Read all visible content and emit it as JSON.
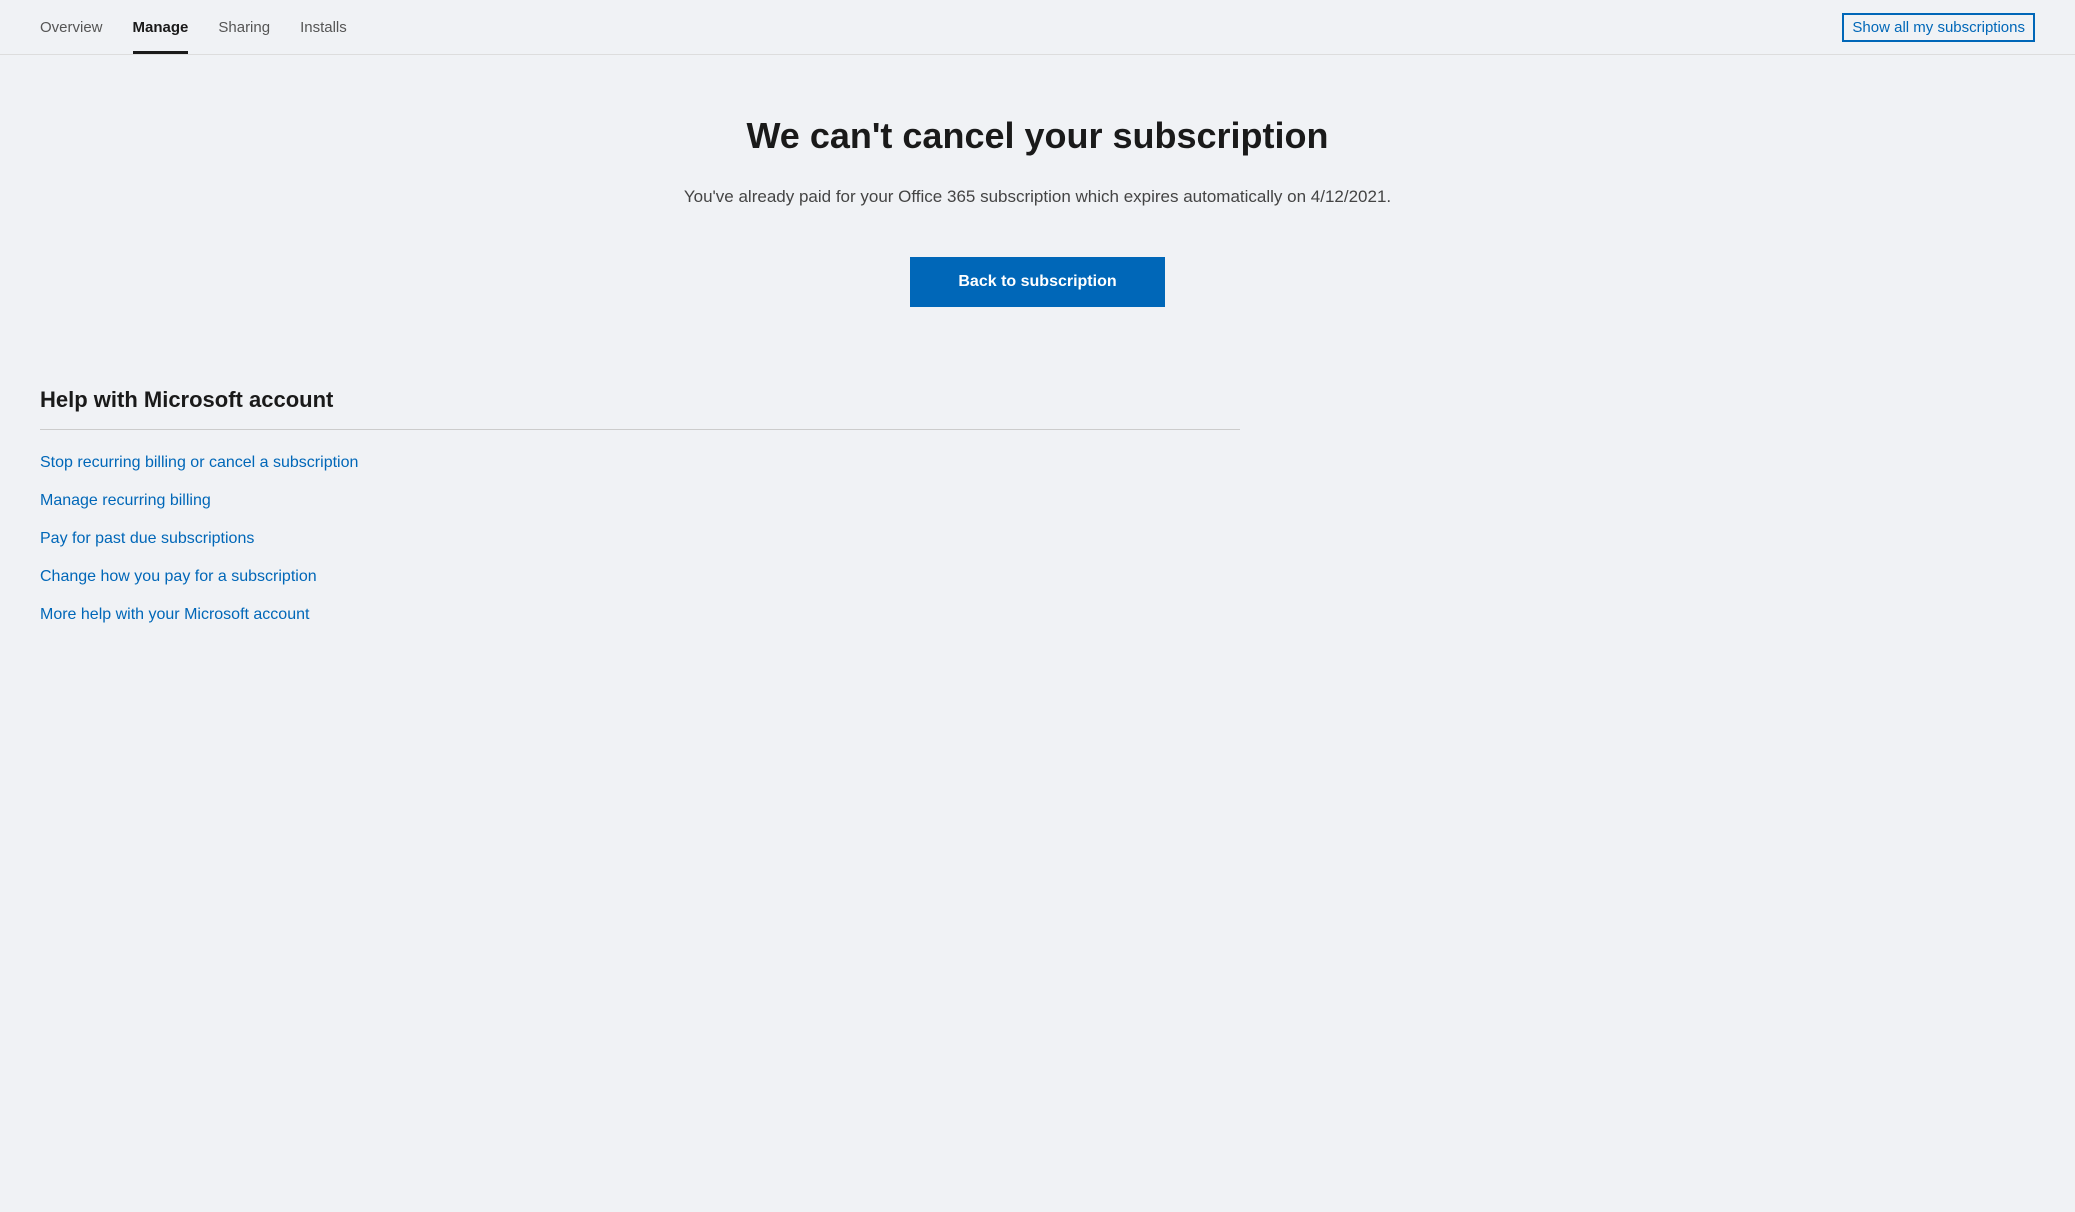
{
  "nav": {
    "tabs": [
      {
        "id": "overview",
        "label": "Overview",
        "active": false
      },
      {
        "id": "manage",
        "label": "Manage",
        "active": true
      },
      {
        "id": "sharing",
        "label": "Sharing",
        "active": false
      },
      {
        "id": "installs",
        "label": "Installs",
        "active": false
      }
    ],
    "show_all_label": "Show all my subscriptions"
  },
  "main": {
    "error_title": "We can't cancel your subscription",
    "error_description": "You've already paid for your Office 365 subscription which expires automatically on 4/12/2021.",
    "back_button_label": "Back to subscription"
  },
  "help": {
    "section_title": "Help with Microsoft account",
    "links": [
      {
        "id": "stop-recurring",
        "label": "Stop recurring billing or cancel a subscription"
      },
      {
        "id": "manage-recurring",
        "label": "Manage recurring billing"
      },
      {
        "id": "pay-past-due",
        "label": "Pay for past due subscriptions"
      },
      {
        "id": "change-payment",
        "label": "Change how you pay for a subscription"
      },
      {
        "id": "more-help",
        "label": "More help with your Microsoft account"
      }
    ]
  }
}
